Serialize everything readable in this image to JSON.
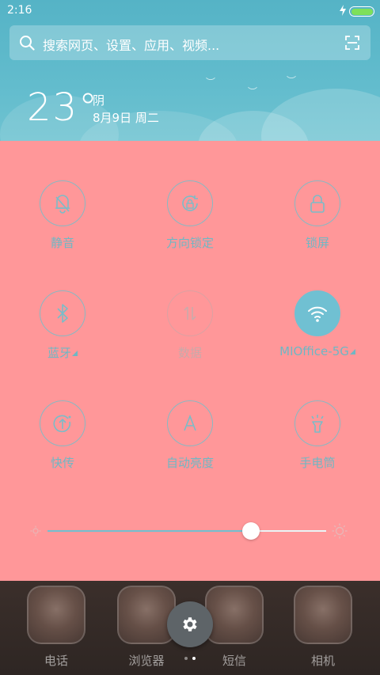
{
  "status_bar": {
    "time": "2:16"
  },
  "search": {
    "placeholder": "搜索网页、设置、应用、视频..."
  },
  "weather": {
    "temperature": "23°",
    "condition": "阴",
    "date": "8月9日 周二"
  },
  "quick_settings": [
    {
      "label": "静音",
      "icon": "bell-off-icon",
      "state": "off"
    },
    {
      "label": "方向锁定",
      "icon": "rotation-lock-icon",
      "state": "off"
    },
    {
      "label": "锁屏",
      "icon": "lock-icon",
      "state": "off"
    },
    {
      "label": "蓝牙",
      "icon": "bluetooth-icon",
      "state": "off"
    },
    {
      "label": "数据",
      "icon": "mobile-data-icon",
      "state": "disabled"
    },
    {
      "label": "MIOffice-5G",
      "icon": "wifi-icon",
      "state": "on"
    },
    {
      "label": "快传",
      "icon": "quick-transfer-icon",
      "state": "off"
    },
    {
      "label": "自动亮度",
      "icon": "auto-brightness-icon",
      "state": "off"
    },
    {
      "label": "手电筒",
      "icon": "flashlight-icon",
      "state": "off"
    }
  ],
  "brightness": {
    "level": 0.73
  },
  "dock": {
    "apps": [
      {
        "label": "电话"
      },
      {
        "label": "浏览器"
      },
      {
        "label": "短信"
      },
      {
        "label": "相机"
      }
    ],
    "page_indicator": {
      "pages": 2,
      "current": 2
    }
  },
  "colors": {
    "panel": "#ff9799",
    "accent": "#70c0d2",
    "header": "#5fb9cb"
  }
}
